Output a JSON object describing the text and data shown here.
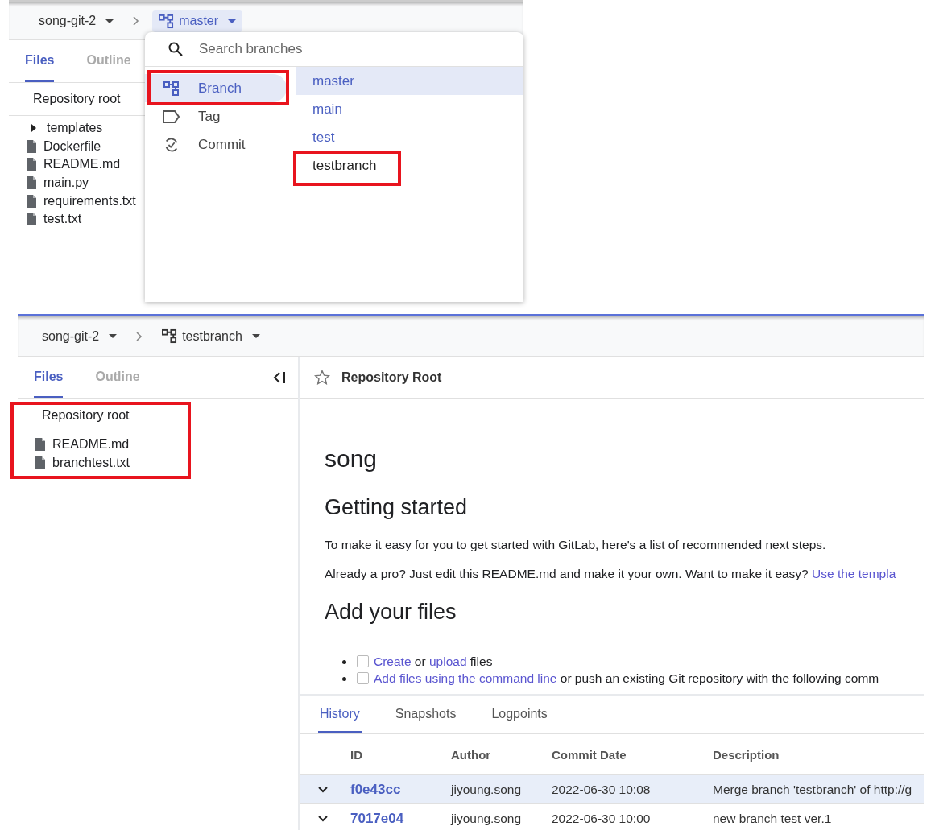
{
  "top": {
    "breadcrumb": {
      "project": "song-git-2",
      "branch": "master"
    },
    "tabs": [
      {
        "label": "Files",
        "selected": true
      },
      {
        "label": "Outline",
        "selected": false
      }
    ],
    "root": "Repository root",
    "tree": [
      {
        "name": "templates",
        "kind": "folder",
        "expanded": false
      },
      {
        "name": "Dockerfile",
        "kind": "file"
      },
      {
        "name": "README.md",
        "kind": "file"
      },
      {
        "name": "main.py",
        "kind": "file"
      },
      {
        "name": "requirements.txt",
        "kind": "file"
      },
      {
        "name": "test.txt",
        "kind": "file"
      }
    ],
    "dropdown": {
      "placeholder": "Search branches",
      "ref_types": [
        {
          "label": "Branch",
          "kind": "branch",
          "selected": true
        },
        {
          "label": "Tag",
          "kind": "tag",
          "selected": false
        },
        {
          "label": "Commit",
          "kind": "commit",
          "selected": false
        }
      ],
      "branches": [
        {
          "name": "master",
          "selected": true,
          "hovered": false
        },
        {
          "name": "main",
          "selected": false,
          "hovered": false
        },
        {
          "name": "test",
          "selected": false,
          "hovered": false
        },
        {
          "name": "testbranch",
          "selected": false,
          "hovered": true
        }
      ]
    }
  },
  "bottom": {
    "breadcrumb": {
      "project": "song-git-2",
      "branch": "testbranch"
    },
    "tabs": [
      {
        "label": "Files",
        "selected": true
      },
      {
        "label": "Outline",
        "selected": false
      }
    ],
    "root": "Repository root",
    "tree": [
      {
        "name": "README.md",
        "kind": "file"
      },
      {
        "name": "branchtest.txt",
        "kind": "file"
      }
    ],
    "doc_title": "Repository Root",
    "readme": [
      {
        "kind": "h1",
        "text": "song"
      },
      {
        "kind": "h2",
        "text": "Getting started"
      },
      {
        "kind": "p",
        "parts": [
          {
            "text": "To make it easy for you to get started with GitLab, here's a list of recommended next steps.",
            "link": false
          }
        ]
      },
      {
        "kind": "p",
        "parts": [
          {
            "text": "Already a pro? Just edit this README.md and make it your own. Want to make it easy?",
            "link": false
          },
          {
            "text": "Use the templa",
            "link": true
          }
        ]
      },
      {
        "kind": "h2",
        "text": "Add your files"
      },
      {
        "kind": "list",
        "items": [
          {
            "checked": false,
            "parts": [
              {
                "text": "Create",
                "link": true
              },
              {
                "text": "or",
                "link": false
              },
              {
                "text": "upload",
                "link": true
              },
              {
                "text": "files",
                "link": false
              }
            ]
          },
          {
            "checked": false,
            "parts": [
              {
                "text": "Add files using the command line",
                "link": true
              },
              {
                "text": "or push an existing Git repository with the following comm",
                "link": false
              }
            ]
          }
        ]
      }
    ],
    "history_tabs": [
      {
        "label": "History",
        "selected": true
      },
      {
        "label": "Snapshots",
        "selected": false
      },
      {
        "label": "Logpoints",
        "selected": false
      }
    ],
    "columns": [
      "ID",
      "Author",
      "Commit Date",
      "Description"
    ],
    "rows": [
      {
        "id": "f0e43cc",
        "author": "jiyoung.song",
        "date": "2022-06-30 10:08",
        "description": "Merge branch 'testbranch' of http://g",
        "selected": true
      },
      {
        "id": "7017e04",
        "author": "jiyoung.song",
        "date": "2022-06-30 10:00",
        "description": "new branch test ver.1",
        "selected": false
      }
    ]
  }
}
